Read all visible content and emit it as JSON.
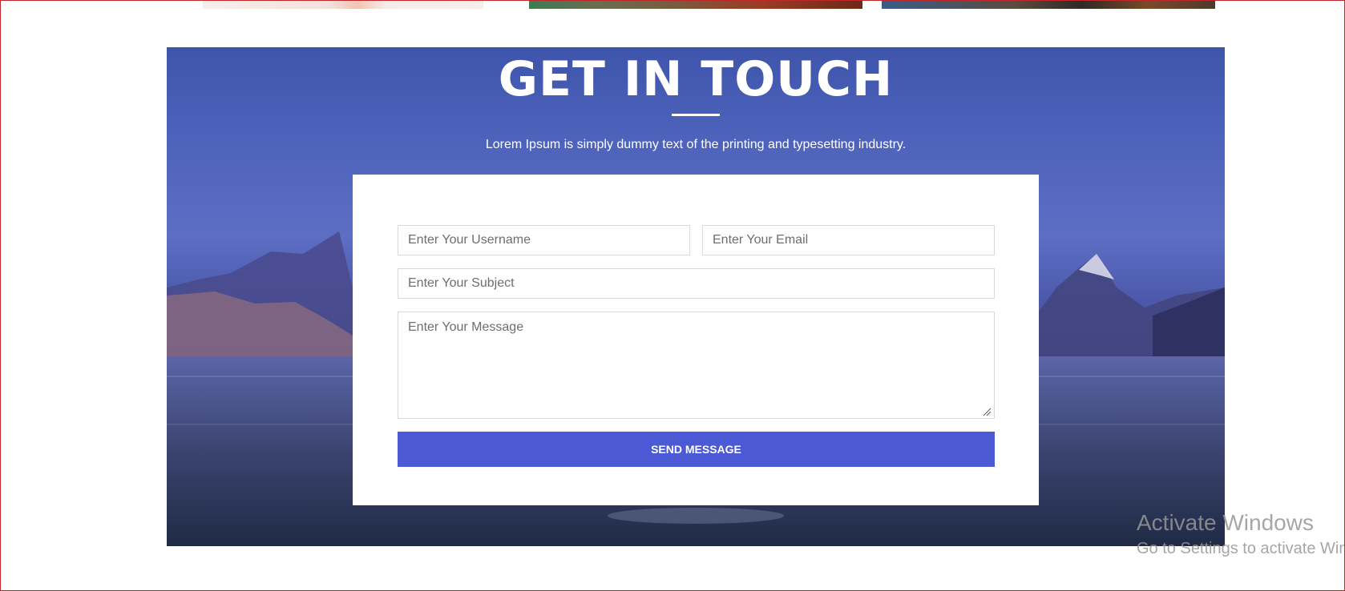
{
  "contact": {
    "title": "GET IN TOUCH",
    "subtitle": "Lorem Ipsum is simply dummy text of the printing and typesetting industry.",
    "username_placeholder": "Enter Your Username",
    "email_placeholder": "Enter Your Email",
    "subject_placeholder": "Enter Your Subject",
    "message_placeholder": "Enter Your Message",
    "send_label": "SEND MESSAGE"
  },
  "watermark": {
    "title": "Activate Windows",
    "subtitle": "Go to Settings to activate Windows."
  },
  "colors": {
    "button": "#4c59d4",
    "hero_overlay": "#4d62bb",
    "border": "#c0272d"
  }
}
